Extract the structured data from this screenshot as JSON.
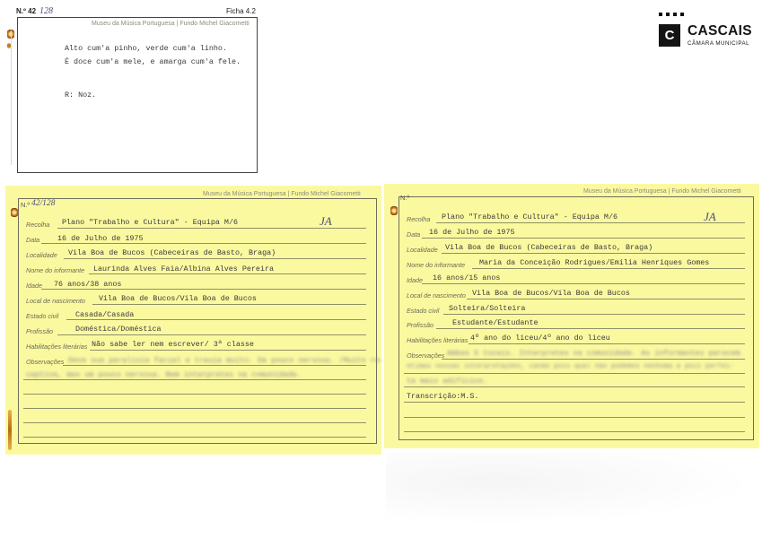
{
  "logo": {
    "name": "CASCAIS",
    "subtitle": "CÂMARA MUNICIPAL"
  },
  "ficha": {
    "number_label": "N.º 42",
    "number_hand": "128",
    "ficha_label": "Ficha 4.2",
    "header": "Museu da Música Portuguesa | Fundo Michel Giacometti",
    "lines": [
      "Alto cum'a pinho, verde cum'a linho.",
      "É doce cum'a mele, e amarga cum'a fele."
    ],
    "answer": "R: Noz."
  },
  "card_left": {
    "header": "Museu da Música Portuguesa | Fundo Michel Giacometti",
    "number_label": "N.º",
    "number_hand": "42/128",
    "mark": "JA",
    "fields": [
      {
        "label": "Recolha",
        "value": "Plano \"Trabalho e Cultura\" - Equipa M/6"
      },
      {
        "label": "Data",
        "value": "16 de Julho de 1975"
      },
      {
        "label": "Localidade",
        "value": "Vila Boa de Bucos (Cabeceiras de Basto, Braga)"
      },
      {
        "label": "Nome do informante",
        "value": "Laurinda Alves Faia/Albina Alves Pereira"
      },
      {
        "label": "Idade",
        "value": "76 anos/38 anos"
      },
      {
        "label": "Local de nascimento",
        "value": "Vila Boa de Bucos/Vila Boa de Bucos"
      },
      {
        "label": "Estado civil",
        "value": "Casada/Casada"
      },
      {
        "label": "Profissão",
        "value": "Doméstica/Doméstica"
      },
      {
        "label": "Habilitações literárias",
        "value": "Não sabe ler nem escrever/ 3ª classe"
      }
    ],
    "observacoes_label": "Observações",
    "observacoes_lines": [
      "Deve sua paralisia facial e treuia muito. Da pouco nervosa. /Muito re-",
      "ceptiva, mas um pouco nervosa. Bem interpretes na comunidade."
    ]
  },
  "card_right": {
    "header": "Museu da Música Portuguesa | Fundo Michel Giacometti",
    "number_label": "N.º",
    "mark": "JA",
    "fields": [
      {
        "label": "Recolha",
        "value": "Plano \"Trabalho e Cultura\" - Equipa M/6"
      },
      {
        "label": "Data",
        "value": "16 de Julho de 1975"
      },
      {
        "label": "Localidade",
        "value": "Vila Boa de Bucos (Cabeceiras de Basto, Braga)"
      },
      {
        "label": "Nome do informante",
        "value": "Maria da Conceição Rodrigues/Emília Henriques Gomes"
      },
      {
        "label": "Idade",
        "value": "16 anos/15 anos"
      },
      {
        "label": "Local de nascimento",
        "value": "Vila Boa de Bucos/Vila Boa de Bucos"
      },
      {
        "label": "Estado civil",
        "value": "Solteira/Solteira"
      },
      {
        "label": "Profissão",
        "value": "Estudante/Estudante"
      },
      {
        "label": "Habilitações literárias",
        "value": "4º ano do liceu/4º ano do liceu"
      }
    ],
    "observacoes_label": "Observações",
    "observacoes_lines": [
      "Ambas 5 tocais. Interpretes na comunidade. As informantes parecem",
      "ótimas nossas interpretações, canão pois qual não podemos nenhuma a pois perfei-",
      "ta mais adifícios."
    ],
    "transcricao": "Transcrição:M.S."
  }
}
